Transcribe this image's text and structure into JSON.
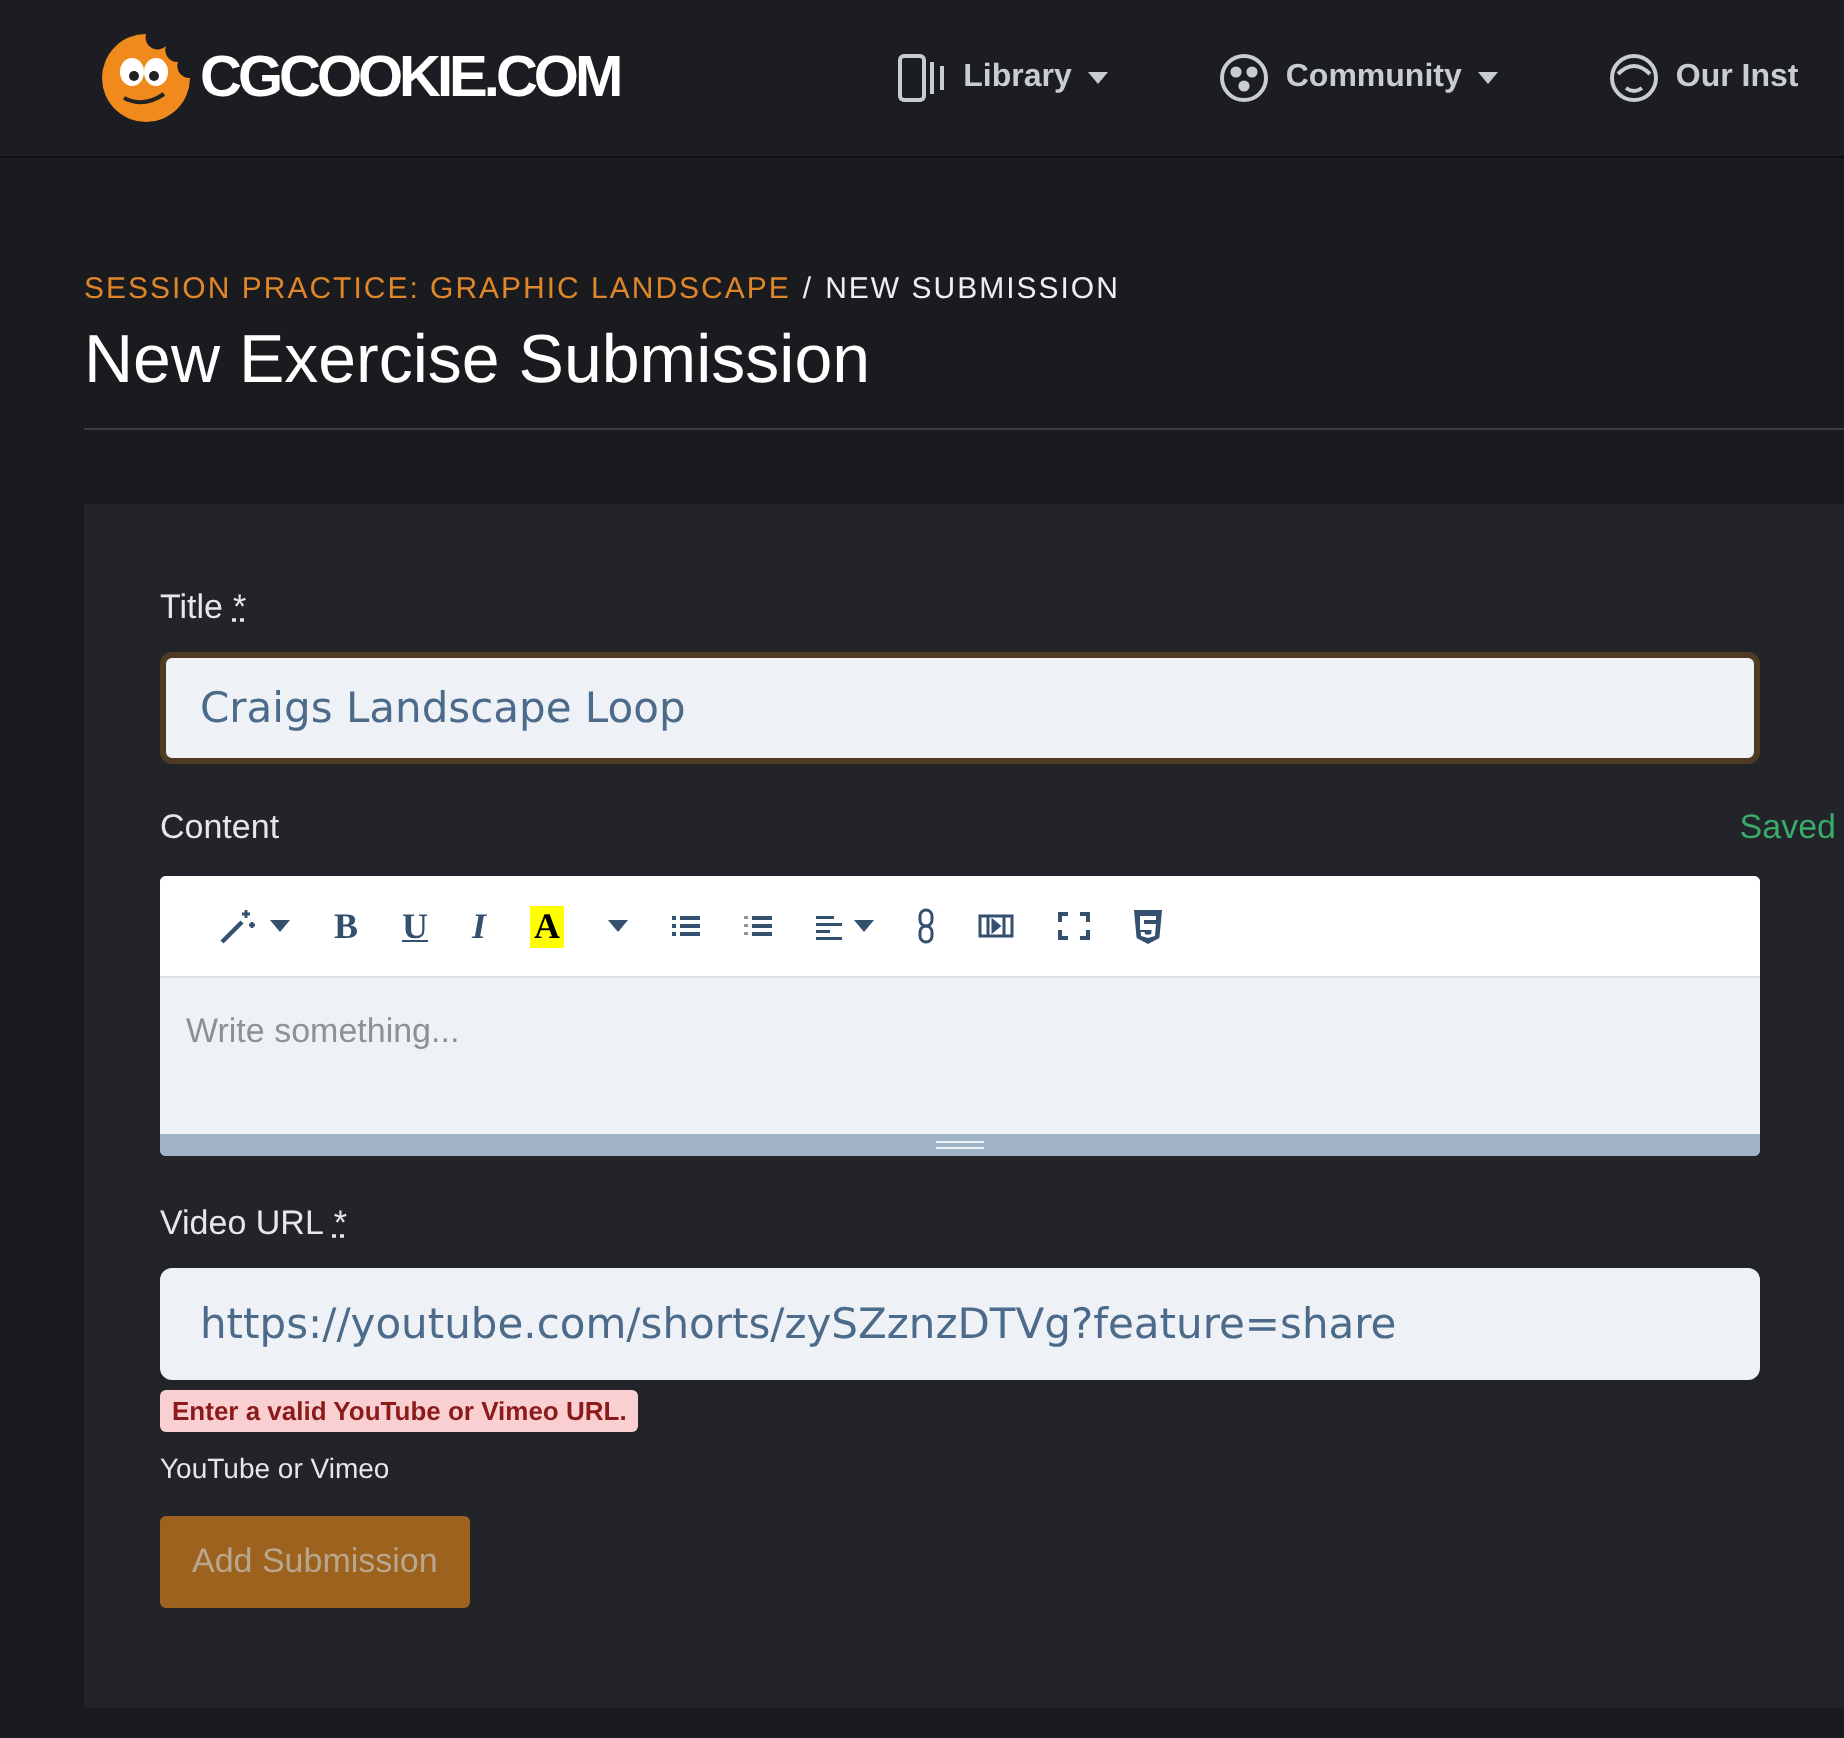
{
  "header": {
    "logo_text": "CGCOOKIE.COM",
    "nav": [
      {
        "label": "Library",
        "kind": "library",
        "dropdown": true
      },
      {
        "label": "Community",
        "kind": "community",
        "dropdown": true
      },
      {
        "label": "Our Inst",
        "kind": "face",
        "dropdown": false
      }
    ]
  },
  "breadcrumb": {
    "parent": "SESSION PRACTICE: GRAPHIC LANDSCAPE",
    "separator": "/",
    "current": "NEW SUBMISSION"
  },
  "page_title": "New Exercise Submission",
  "form": {
    "title_field": {
      "label": "Title",
      "required_mark": "*",
      "value": "Craigs Landscape Loop",
      "focused": true
    },
    "content": {
      "label": "Content",
      "status": "Saved",
      "placeholder": "Write something...",
      "toolbar": [
        {
          "kind": "magic",
          "dropdown": true
        },
        {
          "kind": "bold",
          "text": "B"
        },
        {
          "kind": "underline",
          "text": "U"
        },
        {
          "kind": "italic",
          "text": "I"
        },
        {
          "kind": "highlight",
          "text": "A"
        },
        {
          "kind": "caret"
        },
        {
          "kind": "bullets"
        },
        {
          "kind": "numbers"
        },
        {
          "kind": "align",
          "dropdown": true
        },
        {
          "kind": "link"
        },
        {
          "kind": "video"
        },
        {
          "kind": "fullscreen"
        },
        {
          "kind": "html"
        }
      ]
    },
    "video_field": {
      "label": "Video URL",
      "required_mark": "*",
      "value": "https://youtube.com/shorts/zySZznzDTVg?feature=share",
      "error": "Enter a valid YouTube or Vimeo URL.",
      "help": "YouTube or Vimeo"
    },
    "submit": {
      "label": "Add Submission",
      "disabled": true
    }
  }
}
